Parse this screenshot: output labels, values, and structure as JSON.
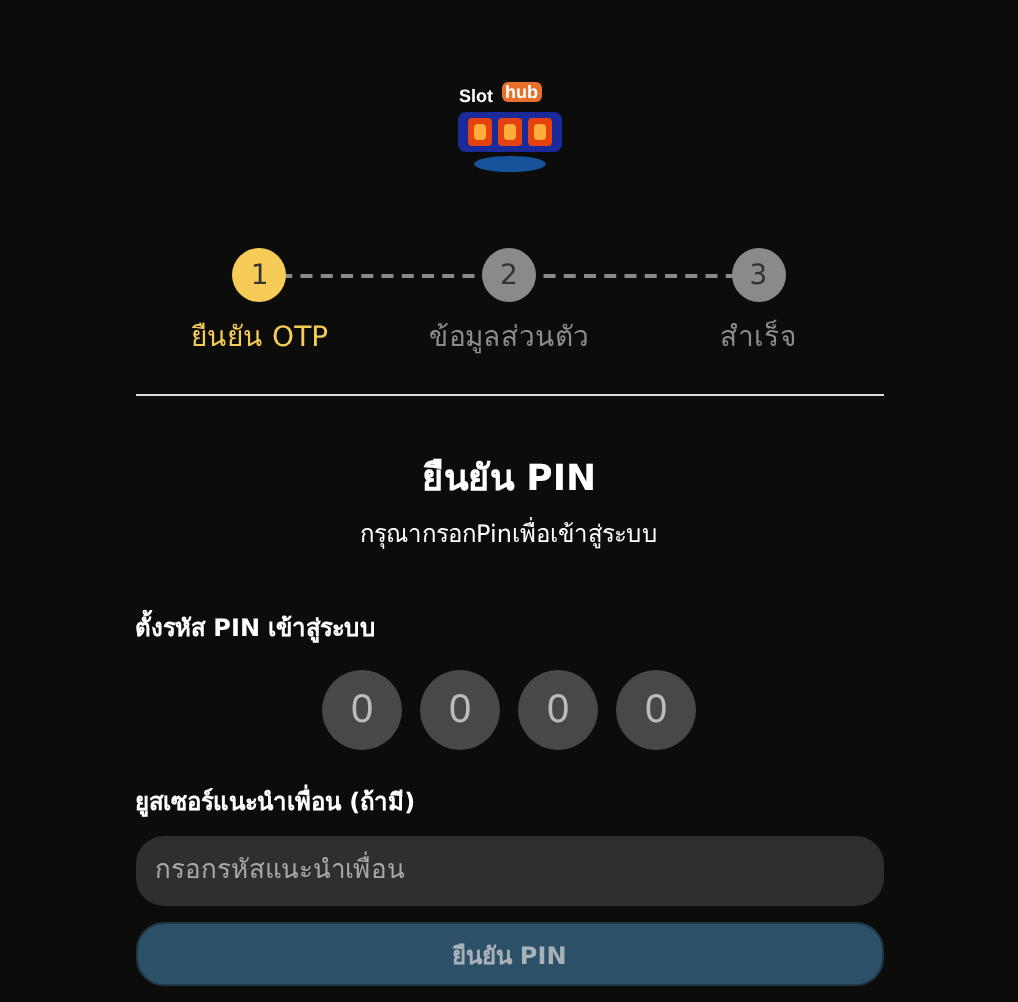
{
  "logo": {
    "word_1": "Slot",
    "word_2": "hub"
  },
  "steps": [
    {
      "number": "1",
      "label": "ยืนยัน OTP",
      "selected": true
    },
    {
      "number": "2",
      "label": "ข้อมูลส่วนตัว",
      "selected": false
    },
    {
      "number": "3",
      "label": "สำเร็จ",
      "selected": false
    }
  ],
  "title": "ยืนยัน PIN",
  "subtitle": "กรุณากรอกPinเพื่อเข้าสู่ระบบ",
  "pin": {
    "label": "ตั้งรหัส PIN เข้าสู่ระบบ",
    "digits": [
      {
        "placeholder": "0"
      },
      {
        "placeholder": "0"
      },
      {
        "placeholder": "0"
      },
      {
        "placeholder": "0"
      }
    ]
  },
  "referral": {
    "label": "ยูสเซอร์แนะนำเพื่อน (ถ้ามี)",
    "placeholder": "กรอกรหัสแนะนำเพื่อน"
  },
  "submit": {
    "label": "ยืนยัน PIN",
    "disabled": true
  }
}
